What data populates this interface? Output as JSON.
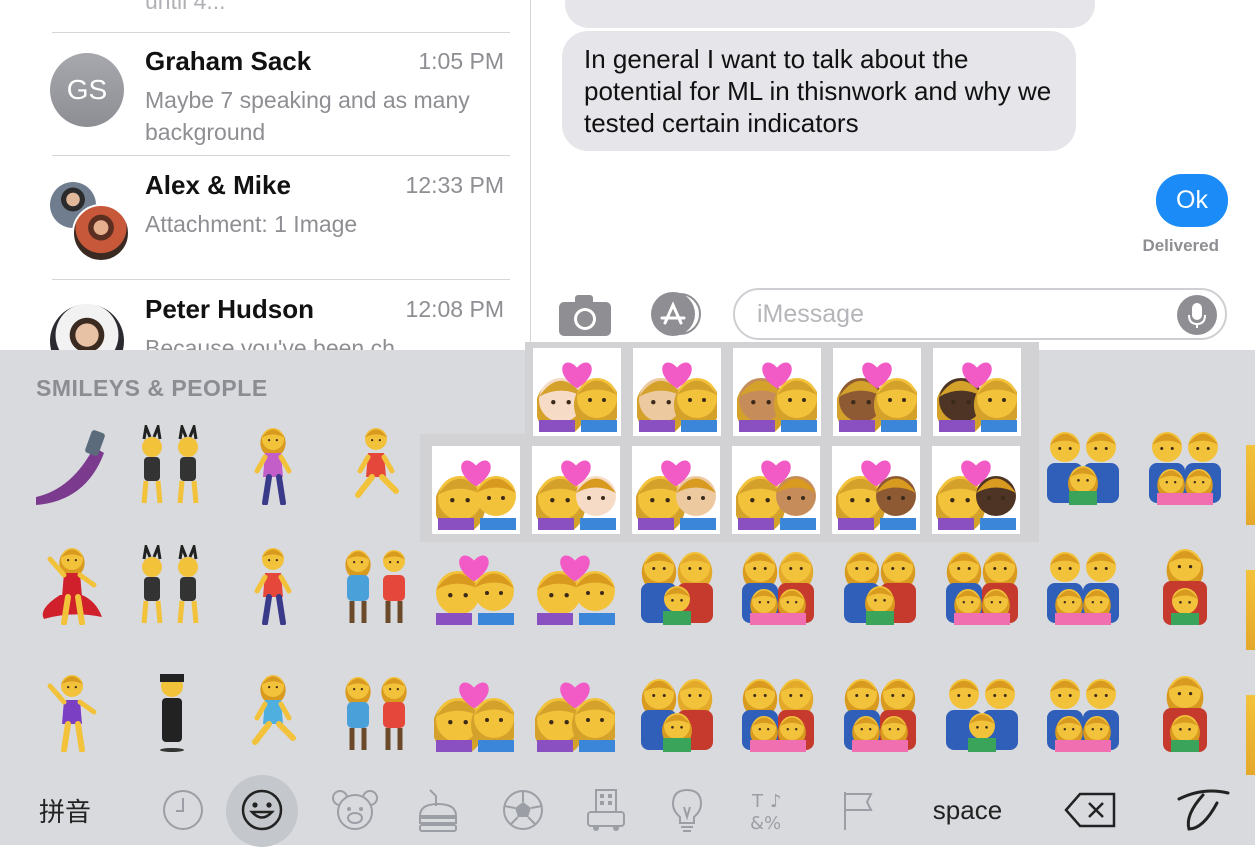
{
  "conversations": {
    "top_cutoff_text": "until 4...",
    "items": [
      {
        "name": "Graham Sack",
        "time": "1:05 PM",
        "preview": "Maybe 7 speaking and as many background",
        "avatar_initials": "GS"
      },
      {
        "name": "Alex & Mike",
        "time": "12:33 PM",
        "preview": "Attachment: 1 Image"
      },
      {
        "name": "Peter Hudson",
        "time": "12:08 PM",
        "preview": "Because you've been ch..."
      }
    ]
  },
  "chat": {
    "incoming_message": "In general I want to talk about the potential for ML in thisnwork and why we tested certain indicators",
    "outgoing_message": "Ok",
    "delivered_label": "Delivered",
    "input_placeholder": "iMessage"
  },
  "emoji_keyboard": {
    "section_title": "SMILEYS & PEOPLE",
    "bottom_bar": {
      "pinyin_label": "拼音",
      "space_label": "space",
      "categories": [
        "recent-icon",
        "smiley-icon",
        "animal-icon",
        "food-icon",
        "sports-icon",
        "travel-icon",
        "objects-icon",
        "symbols-icon",
        "flags-icon"
      ],
      "selected_category": "smiley-icon"
    },
    "variant_popover": {
      "row1": [
        "kiss-woman-light",
        "kiss-woman-medium-light",
        "kiss-woman-medium",
        "kiss-woman-medium-dark",
        "kiss-woman-dark"
      ],
      "row2": [
        "kiss-default",
        "kiss-man-light",
        "kiss-man-medium-light",
        "kiss-man-medium",
        "kiss-man-medium-dark",
        "kiss-man-dark"
      ]
    },
    "grid": [
      [
        "selfie",
        "women-with-bunny-ears",
        "woman-walking",
        "man-running",
        "kiss",
        "kiss",
        "kiss",
        "kiss",
        "kiss",
        "kiss",
        "family-man-man-girl",
        "family-man-man-girl-girl"
      ],
      [
        "woman-dancing",
        "men-with-bunny-ears",
        "man-walking",
        "man-and-woman-holding-hands",
        "couple-kiss-woman-man",
        "couple-kiss-man-man",
        "family-man-woman-boy",
        "family-man-woman-boy-boy",
        "family-woman-woman-girl",
        "family-woman-woman-girl-girl",
        "family-man-man-girl-boy",
        "family-woman-boy"
      ],
      [
        "man-dancing",
        "man-in-business-suit-levitating",
        "woman-running",
        "two-women-holding-hands",
        "couple-kiss-woman-woman",
        "couple-kiss-woman-woman-2",
        "family-man-woman-girl",
        "family-man-woman-girl-girl",
        "family-woman-woman-girl-boy",
        "family-man-man-boy",
        "family-man-man-boy-boy",
        "family-woman-girl"
      ]
    ]
  }
}
